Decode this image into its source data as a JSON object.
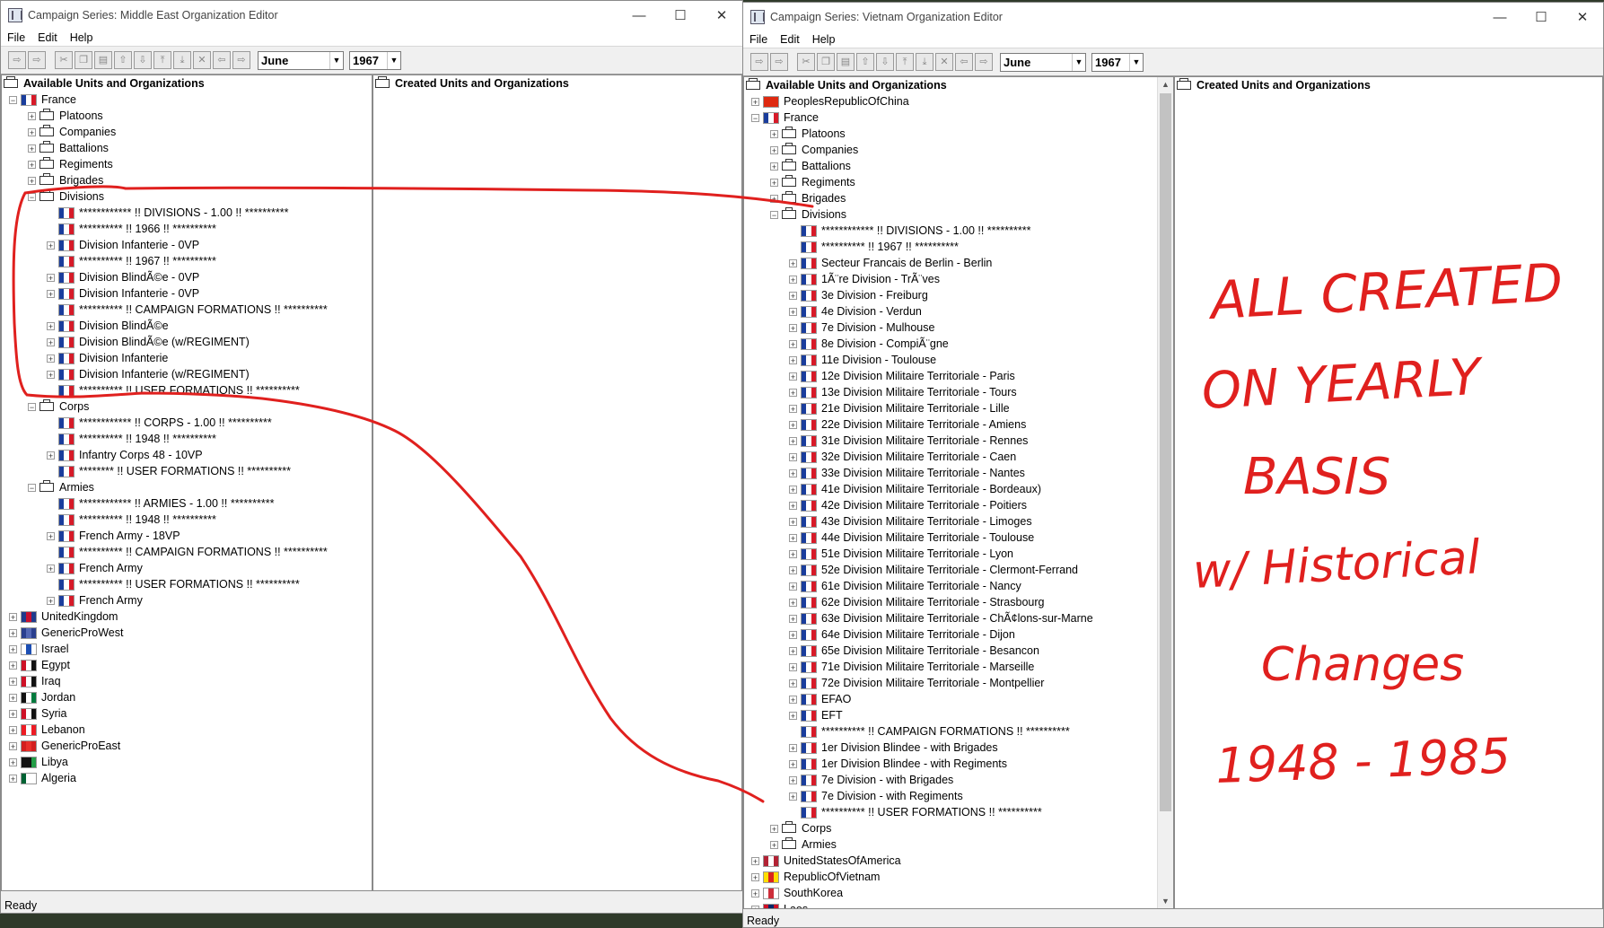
{
  "left_window": {
    "title": "Campaign Series: Middle East Organization Editor",
    "menu": [
      "File",
      "Edit",
      "Help"
    ],
    "month": "June",
    "year": "1967",
    "available_header": "Available Units and Organizations",
    "created_header": "Created Units and Organizations",
    "status": "Ready"
  },
  "right_window": {
    "title": "Campaign Series: Vietnam Organization Editor",
    "menu": [
      "File",
      "Edit",
      "Help"
    ],
    "month": "June",
    "year": "1967",
    "available_header": "Available Units and Organizations",
    "created_header": "Created Units and Organizations",
    "status": "Ready"
  },
  "caption_buttons": {
    "minimize": "—",
    "maximize": "☐",
    "close": "✕"
  },
  "toolbar_icons": [
    "arrow-right-icon",
    "arrow-right-alt-icon",
    "cut-icon",
    "copy-icon",
    "paste-icon",
    "move-up-icon",
    "move-down-icon",
    "move-top-icon",
    "move-bottom-icon",
    "delete-icon",
    "arrow-left-icon",
    "arrow-right-2-icon"
  ],
  "left_tree": [
    {
      "depth": 0,
      "exp": "-",
      "icon": "flag-fr",
      "label": "France"
    },
    {
      "depth": 1,
      "exp": "+",
      "icon": "box",
      "label": "Platoons"
    },
    {
      "depth": 1,
      "exp": "+",
      "icon": "box",
      "label": "Companies"
    },
    {
      "depth": 1,
      "exp": "+",
      "icon": "box",
      "label": "Battalions"
    },
    {
      "depth": 1,
      "exp": "+",
      "icon": "box",
      "label": "Regiments"
    },
    {
      "depth": 1,
      "exp": "+",
      "icon": "box",
      "label": "Brigades"
    },
    {
      "depth": 1,
      "exp": "-",
      "icon": "box",
      "label": "Divisions"
    },
    {
      "depth": 2,
      "exp": "",
      "icon": "flag-fr",
      "label": "************ !! DIVISIONS - 1.00 !! **********"
    },
    {
      "depth": 2,
      "exp": "",
      "icon": "flag-fr",
      "label": "********** !! 1966 !! **********"
    },
    {
      "depth": 2,
      "exp": "+",
      "icon": "flag-fr",
      "label": "Division Infanterie - 0VP"
    },
    {
      "depth": 2,
      "exp": "",
      "icon": "flag-fr",
      "label": "********** !! 1967 !! **********"
    },
    {
      "depth": 2,
      "exp": "+",
      "icon": "flag-fr",
      "label": "Division BlindÃ©e - 0VP"
    },
    {
      "depth": 2,
      "exp": "+",
      "icon": "flag-fr",
      "label": "Division Infanterie - 0VP"
    },
    {
      "depth": 2,
      "exp": "",
      "icon": "flag-fr",
      "label": "********** !! CAMPAIGN FORMATIONS !! **********"
    },
    {
      "depth": 2,
      "exp": "+",
      "icon": "flag-fr",
      "label": "Division BlindÃ©e"
    },
    {
      "depth": 2,
      "exp": "+",
      "icon": "flag-fr",
      "label": "Division BlindÃ©e (w/REGIMENT)"
    },
    {
      "depth": 2,
      "exp": "+",
      "icon": "flag-fr",
      "label": "Division Infanterie"
    },
    {
      "depth": 2,
      "exp": "+",
      "icon": "flag-fr",
      "label": "Division Infanterie (w/REGIMENT)"
    },
    {
      "depth": 2,
      "exp": "",
      "icon": "flag-fr",
      "label": "********** !! USER FORMATIONS !! **********"
    },
    {
      "depth": 1,
      "exp": "-",
      "icon": "box",
      "label": "Corps"
    },
    {
      "depth": 2,
      "exp": "",
      "icon": "flag-fr",
      "label": "************ !! CORPS - 1.00 !! **********"
    },
    {
      "depth": 2,
      "exp": "",
      "icon": "flag-fr",
      "label": "********** !! 1948 !! **********"
    },
    {
      "depth": 2,
      "exp": "+",
      "icon": "flag-fr",
      "label": "Infantry Corps 48 - 10VP"
    },
    {
      "depth": 2,
      "exp": "",
      "icon": "flag-fr",
      "label": "******** !! USER FORMATIONS !! **********"
    },
    {
      "depth": 1,
      "exp": "-",
      "icon": "box",
      "label": "Armies"
    },
    {
      "depth": 2,
      "exp": "",
      "icon": "flag-fr",
      "label": "************ !! ARMIES - 1.00 !! **********"
    },
    {
      "depth": 2,
      "exp": "",
      "icon": "flag-fr",
      "label": "********** !! 1948 !! **********"
    },
    {
      "depth": 2,
      "exp": "+",
      "icon": "flag-fr",
      "label": "French Army - 18VP"
    },
    {
      "depth": 2,
      "exp": "",
      "icon": "flag-fr",
      "label": "********** !! CAMPAIGN FORMATIONS !! **********"
    },
    {
      "depth": 2,
      "exp": "+",
      "icon": "flag-fr",
      "label": "French Army"
    },
    {
      "depth": 2,
      "exp": "",
      "icon": "flag-fr",
      "label": "********** !! USER FORMATIONS !! **********"
    },
    {
      "depth": 2,
      "exp": "+",
      "icon": "flag-fr",
      "label": "French Army"
    },
    {
      "depth": 0,
      "exp": "+",
      "icon": "flag-uk",
      "label": "UnitedKingdom"
    },
    {
      "depth": 0,
      "exp": "+",
      "icon": "flag-generic-west",
      "label": "GenericProWest"
    },
    {
      "depth": 0,
      "exp": "+",
      "icon": "flag-il",
      "label": "Israel"
    },
    {
      "depth": 0,
      "exp": "+",
      "icon": "flag-eg",
      "label": "Egypt"
    },
    {
      "depth": 0,
      "exp": "+",
      "icon": "flag-iq",
      "label": "Iraq"
    },
    {
      "depth": 0,
      "exp": "+",
      "icon": "flag-jo",
      "label": "Jordan"
    },
    {
      "depth": 0,
      "exp": "+",
      "icon": "flag-sy",
      "label": "Syria"
    },
    {
      "depth": 0,
      "exp": "+",
      "icon": "flag-lb",
      "label": "Lebanon"
    },
    {
      "depth": 0,
      "exp": "+",
      "icon": "flag-generic-east",
      "label": "GenericProEast"
    },
    {
      "depth": 0,
      "exp": "+",
      "icon": "flag-ly",
      "label": "Libya"
    },
    {
      "depth": 0,
      "exp": "+",
      "icon": "flag-dz",
      "label": "Algeria"
    }
  ],
  "right_tree": [
    {
      "depth": 0,
      "exp": "+",
      "icon": "flag-cn",
      "label": "PeoplesRepublicOfChina"
    },
    {
      "depth": 0,
      "exp": "-",
      "icon": "flag-fr",
      "label": "France"
    },
    {
      "depth": 1,
      "exp": "+",
      "icon": "box",
      "label": "Platoons"
    },
    {
      "depth": 1,
      "exp": "+",
      "icon": "box",
      "label": "Companies"
    },
    {
      "depth": 1,
      "exp": "+",
      "icon": "box",
      "label": "Battalions"
    },
    {
      "depth": 1,
      "exp": "+",
      "icon": "box",
      "label": "Regiments"
    },
    {
      "depth": 1,
      "exp": "+",
      "icon": "box",
      "label": "Brigades"
    },
    {
      "depth": 1,
      "exp": "-",
      "icon": "box",
      "label": "Divisions"
    },
    {
      "depth": 2,
      "exp": "",
      "icon": "flag-fr",
      "label": "************ !! DIVISIONS - 1.00 !! **********"
    },
    {
      "depth": 2,
      "exp": "",
      "icon": "flag-fr",
      "label": "********** !! 1967 !! **********"
    },
    {
      "depth": 2,
      "exp": "+",
      "icon": "flag-fr",
      "label": "Secteur Francais de Berlin - Berlin"
    },
    {
      "depth": 2,
      "exp": "+",
      "icon": "flag-fr",
      "label": "1Ã¨re Division - TrÃ¨ves"
    },
    {
      "depth": 2,
      "exp": "+",
      "icon": "flag-fr",
      "label": "3e Division - Freiburg"
    },
    {
      "depth": 2,
      "exp": "+",
      "icon": "flag-fr",
      "label": "4e Division - Verdun"
    },
    {
      "depth": 2,
      "exp": "+",
      "icon": "flag-fr",
      "label": "7e Division - Mulhouse"
    },
    {
      "depth": 2,
      "exp": "+",
      "icon": "flag-fr",
      "label": "8e Division - CompiÃ¨gne"
    },
    {
      "depth": 2,
      "exp": "+",
      "icon": "flag-fr",
      "label": "11e Division - Toulouse"
    },
    {
      "depth": 2,
      "exp": "+",
      "icon": "flag-fr",
      "label": "12e Division Militaire Territoriale - Paris"
    },
    {
      "depth": 2,
      "exp": "+",
      "icon": "flag-fr",
      "label": "13e Division Militaire Territoriale - Tours"
    },
    {
      "depth": 2,
      "exp": "+",
      "icon": "flag-fr",
      "label": "21e Division Militaire Territoriale - Lille"
    },
    {
      "depth": 2,
      "exp": "+",
      "icon": "flag-fr",
      "label": "22e Division Militaire Territoriale - Amiens"
    },
    {
      "depth": 2,
      "exp": "+",
      "icon": "flag-fr",
      "label": "31e Division Militaire Territoriale - Rennes"
    },
    {
      "depth": 2,
      "exp": "+",
      "icon": "flag-fr",
      "label": "32e Division Militaire Territoriale - Caen"
    },
    {
      "depth": 2,
      "exp": "+",
      "icon": "flag-fr",
      "label": "33e Division Militaire Territoriale - Nantes"
    },
    {
      "depth": 2,
      "exp": "+",
      "icon": "flag-fr",
      "label": "41e Division Militaire Territoriale - Bordeaux)"
    },
    {
      "depth": 2,
      "exp": "+",
      "icon": "flag-fr",
      "label": "42e Division Militaire Territoriale - Poitiers"
    },
    {
      "depth": 2,
      "exp": "+",
      "icon": "flag-fr",
      "label": "43e Division Militaire Territoriale - Limoges"
    },
    {
      "depth": 2,
      "exp": "+",
      "icon": "flag-fr",
      "label": "44e Division Militaire Territoriale - Toulouse"
    },
    {
      "depth": 2,
      "exp": "+",
      "icon": "flag-fr",
      "label": "51e Division Militaire Territoriale - Lyon"
    },
    {
      "depth": 2,
      "exp": "+",
      "icon": "flag-fr",
      "label": "52e Division Militaire Territoriale - Clermont-Ferrand"
    },
    {
      "depth": 2,
      "exp": "+",
      "icon": "flag-fr",
      "label": "61e Division Militaire Territoriale - Nancy"
    },
    {
      "depth": 2,
      "exp": "+",
      "icon": "flag-fr",
      "label": "62e Division Militaire Territoriale - Strasbourg"
    },
    {
      "depth": 2,
      "exp": "+",
      "icon": "flag-fr",
      "label": "63e Division Militaire Territoriale - ChÃ¢lons-sur-Marne"
    },
    {
      "depth": 2,
      "exp": "+",
      "icon": "flag-fr",
      "label": "64e Division Militaire Territoriale - Dijon"
    },
    {
      "depth": 2,
      "exp": "+",
      "icon": "flag-fr",
      "label": "65e Division Militaire Territoriale - Besancon"
    },
    {
      "depth": 2,
      "exp": "+",
      "icon": "flag-fr",
      "label": "71e Division Militaire Territoriale - Marseille"
    },
    {
      "depth": 2,
      "exp": "+",
      "icon": "flag-fr",
      "label": "72e Division Militaire Territoriale - Montpellier"
    },
    {
      "depth": 2,
      "exp": "+",
      "icon": "flag-fr",
      "label": "EFAO"
    },
    {
      "depth": 2,
      "exp": "+",
      "icon": "flag-fr",
      "label": "EFT"
    },
    {
      "depth": 2,
      "exp": "",
      "icon": "flag-fr",
      "label": "********** !! CAMPAIGN FORMATIONS !! **********"
    },
    {
      "depth": 2,
      "exp": "+",
      "icon": "flag-fr",
      "label": "1er Division Blindee - with Brigades"
    },
    {
      "depth": 2,
      "exp": "+",
      "icon": "flag-fr",
      "label": "1er Division Blindee - with Regiments"
    },
    {
      "depth": 2,
      "exp": "+",
      "icon": "flag-fr",
      "label": "7e Division - with Brigades"
    },
    {
      "depth": 2,
      "exp": "+",
      "icon": "flag-fr",
      "label": "7e Division - with Regiments"
    },
    {
      "depth": 2,
      "exp": "",
      "icon": "flag-fr",
      "label": "********** !! USER FORMATIONS !! **********"
    },
    {
      "depth": 1,
      "exp": "+",
      "icon": "box",
      "label": "Corps"
    },
    {
      "depth": 1,
      "exp": "+",
      "icon": "box",
      "label": "Armies"
    },
    {
      "depth": 0,
      "exp": "+",
      "icon": "flag-us",
      "label": "UnitedStatesOfAmerica"
    },
    {
      "depth": 0,
      "exp": "+",
      "icon": "flag-rvn",
      "label": "RepublicOfVietnam"
    },
    {
      "depth": 0,
      "exp": "+",
      "icon": "flag-kr",
      "label": "SouthKorea"
    },
    {
      "depth": 0,
      "exp": "+",
      "icon": "flag-la",
      "label": "Laos"
    }
  ],
  "annotation": {
    "lines": [
      "ALL CREATED",
      "ON YEARLY",
      "BASIS",
      "w/ Historical",
      "Changes",
      "1948 - 1985"
    ],
    "color": "#e0201e"
  },
  "flag_colors": {
    "flag-fr": [
      "#1a3d9c",
      "#ffffff",
      "#d71a28"
    ],
    "flag-uk": [
      "#1f3b8c",
      "#c8102e",
      "#1f3b8c"
    ],
    "flag-generic-west": [
      "#2a3f8f",
      "#5468b5",
      "#2a3f8f"
    ],
    "flag-il": [
      "#ffffff",
      "#1c4fb4",
      "#ffffff"
    ],
    "flag-eg": [
      "#ce1126",
      "#ffffff",
      "#111111"
    ],
    "flag-iq": [
      "#ce1126",
      "#ffffff",
      "#111111"
    ],
    "flag-jo": [
      "#111111",
      "#ffffff",
      "#007a3d"
    ],
    "flag-sy": [
      "#ce1126",
      "#ffffff",
      "#111111"
    ],
    "flag-lb": [
      "#ed1c24",
      "#ffffff",
      "#ed1c24"
    ],
    "flag-generic-east": [
      "#d31f1f",
      "#e8302b",
      "#d31f1f"
    ],
    "flag-ly": [
      "#111111",
      "#111111",
      "#239e46"
    ],
    "flag-dz": [
      "#006233",
      "#ffffff",
      "#ffffff"
    ],
    "flag-cn": [
      "#de2910",
      "#de2910",
      "#de2910"
    ],
    "flag-us": [
      "#b22234",
      "#ffffff",
      "#b22234"
    ],
    "flag-rvn": [
      "#ffdd00",
      "#da251d",
      "#ffdd00"
    ],
    "flag-kr": [
      "#ffffff",
      "#cd2e3a",
      "#ffffff"
    ],
    "flag-la": [
      "#ce1126",
      "#002868",
      "#ce1126"
    ]
  }
}
